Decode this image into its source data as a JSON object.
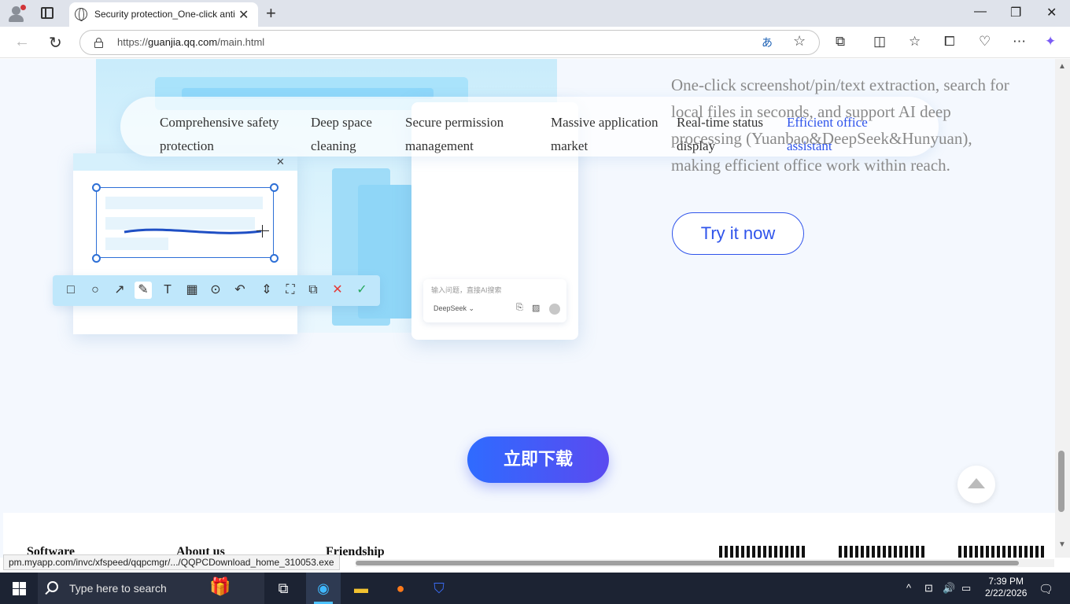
{
  "browser": {
    "tab_title": "Security protection_One-click anti",
    "url_prefix": "https://",
    "url_host": "guanjia.qq.com",
    "url_path": "/main.html"
  },
  "features": {
    "tabs": [
      {
        "label": "Comprehensive safety protection",
        "active": false
      },
      {
        "label": "Deep space cleaning",
        "active": false
      },
      {
        "label": "Secure permission management",
        "active": false
      },
      {
        "label": "Massive application market",
        "active": false
      },
      {
        "label": "Real-time status display",
        "active": false
      },
      {
        "label": "Efficient office assistant",
        "active": true
      }
    ],
    "description": "One-click screenshot/pin/text extraction, search for local files in seconds, and support AI deep processing (Yuanbao&DeepSeek&Hunyuan), making efficient office work within reach.",
    "try_button": "Try it now"
  },
  "illustration": {
    "ai_input_placeholder": "输入问题，直接AI搜索",
    "ai_model": "DeepSeek"
  },
  "download_button": "立即下载",
  "footer": {
    "headings": [
      "Software",
      "About us",
      "Friendship"
    ]
  },
  "status_url": "pm.myapp.com/invc/xfspeed/qqpcmgr/.../QQPCDownload_home_310053.exe",
  "taskbar": {
    "search_placeholder": "Type here to search",
    "time": "7:39 PM",
    "date": "2/22/2026"
  },
  "colors": {
    "accent": "#2f54eb",
    "download_gradient_start": "#2f6bff",
    "download_gradient_end": "#5a4af0"
  }
}
